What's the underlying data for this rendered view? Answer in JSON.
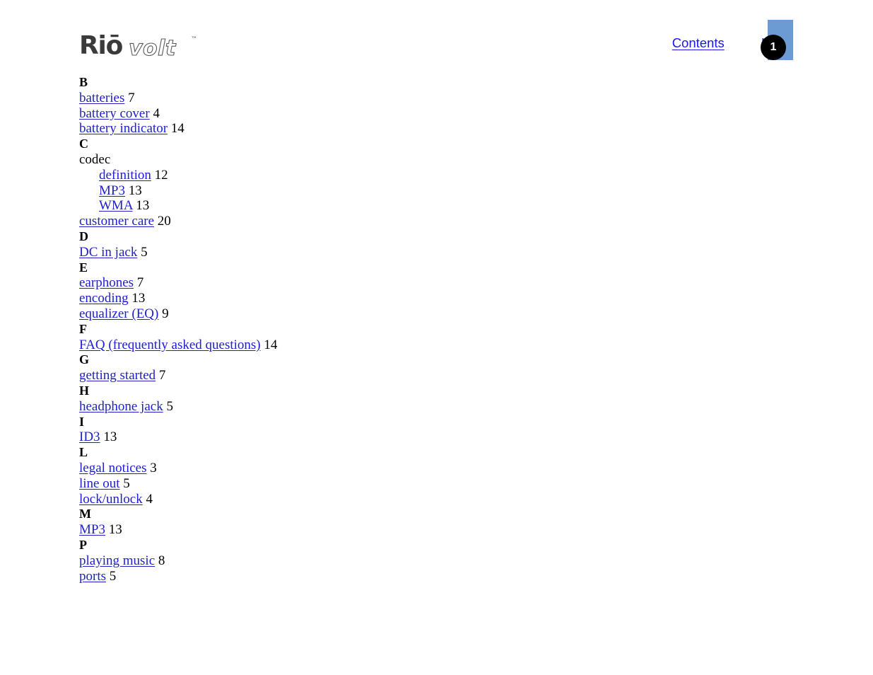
{
  "header": {
    "logo": {
      "primary_text": "Riō",
      "secondary_text": "volt",
      "trademark": "™",
      "primary_color": "#3a3a3a",
      "secondary_color": "#5a5a5a"
    },
    "nav_links": [
      {
        "label": "Contents"
      },
      {
        "label": "Index"
      }
    ],
    "page_badge": "1",
    "tab_color": "#6b9bd2",
    "link_color": "#1717e8"
  },
  "index": {
    "entry_link_color": "#2020cf",
    "rows": [
      {
        "kind": "section",
        "label": "B"
      },
      {
        "kind": "entry",
        "label": "batteries",
        "page": "7"
      },
      {
        "kind": "entry",
        "label": "battery cover",
        "page": "4"
      },
      {
        "kind": "entry",
        "label": "battery indicator",
        "page": "14"
      },
      {
        "kind": "section",
        "label": "C"
      },
      {
        "kind": "plain",
        "label": "codec"
      },
      {
        "kind": "sub",
        "label": "definition",
        "page": "12"
      },
      {
        "kind": "sub",
        "label": "MP3",
        "page": "13"
      },
      {
        "kind": "sub",
        "label": "WMA",
        "page": "13"
      },
      {
        "kind": "entry",
        "label": "customer care",
        "page": "20"
      },
      {
        "kind": "section",
        "label": "D"
      },
      {
        "kind": "entry",
        "label": "DC in jack",
        "page": "5"
      },
      {
        "kind": "section",
        "label": "E"
      },
      {
        "kind": "entry",
        "label": "earphones",
        "page": "7"
      },
      {
        "kind": "entry",
        "label": "encoding",
        "page": "13"
      },
      {
        "kind": "entry",
        "label": "equalizer (EQ)",
        "page": "9"
      },
      {
        "kind": "section",
        "label": "F"
      },
      {
        "kind": "entry",
        "label": "FAQ (frequently asked questions)",
        "page": "14"
      },
      {
        "kind": "section",
        "label": "G"
      },
      {
        "kind": "entry",
        "label": "getting started",
        "page": "7"
      },
      {
        "kind": "section",
        "label": "H"
      },
      {
        "kind": "entry",
        "label": "headphone jack",
        "page": "5"
      },
      {
        "kind": "section",
        "label": "I"
      },
      {
        "kind": "entry",
        "label": "ID3",
        "page": "13"
      },
      {
        "kind": "section",
        "label": "L"
      },
      {
        "kind": "entry",
        "label": "legal notices",
        "page": "3"
      },
      {
        "kind": "entry",
        "label": "line out",
        "page": "5"
      },
      {
        "kind": "entry",
        "label": "lock/unlock",
        "page": "4"
      },
      {
        "kind": "section",
        "label": "M"
      },
      {
        "kind": "entry",
        "label": "MP3",
        "page": "13"
      },
      {
        "kind": "section",
        "label": "P"
      },
      {
        "kind": "entry",
        "label": "playing music",
        "page": "8"
      },
      {
        "kind": "entry",
        "label": "ports",
        "page": "5"
      }
    ]
  }
}
